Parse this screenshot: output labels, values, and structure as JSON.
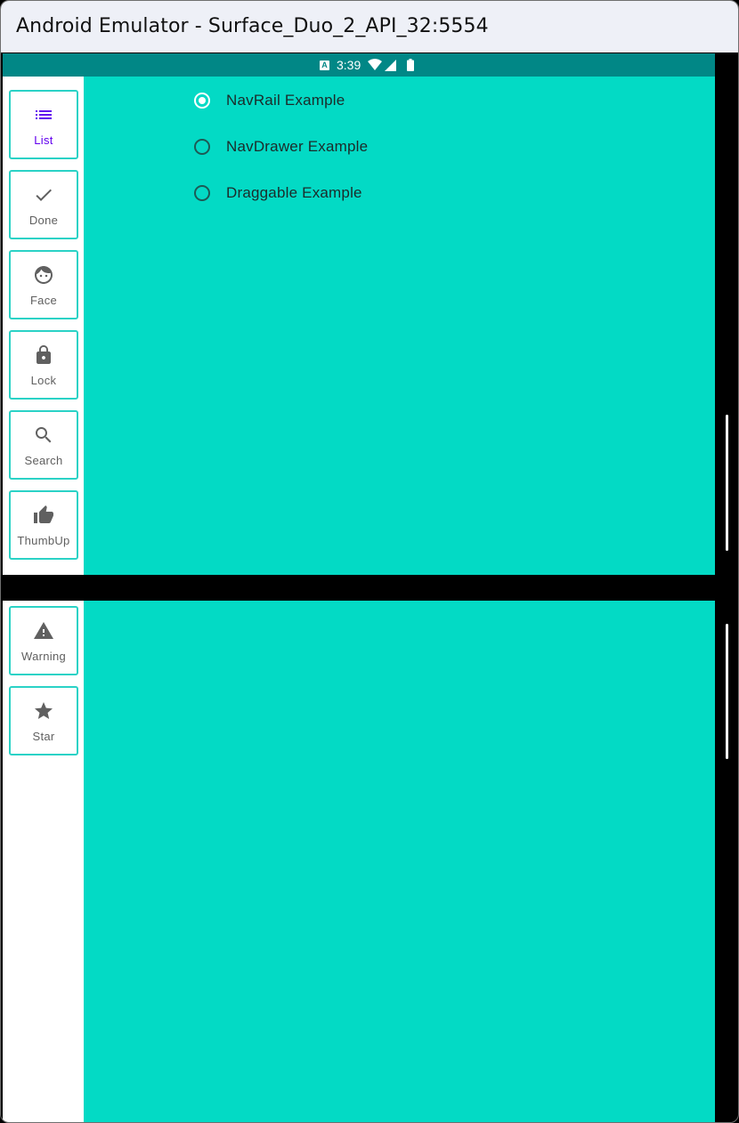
{
  "window": {
    "title": "Android Emulator - Surface_Duo_2_API_32:5554"
  },
  "status_bar": {
    "time": "3:39",
    "icons": [
      "a-notification-icon",
      "wifi-icon",
      "cell-signal-icon",
      "battery-icon"
    ]
  },
  "colors": {
    "status_bar": "#018786",
    "content": "#03dac5",
    "rail_border": "#2ad2c6",
    "selected": "#6200ee"
  },
  "rail_top": [
    {
      "label": "List",
      "icon": "list-icon",
      "selected": true
    },
    {
      "label": "Done",
      "icon": "check-icon",
      "selected": false
    },
    {
      "label": "Face",
      "icon": "face-icon",
      "selected": false
    },
    {
      "label": "Lock",
      "icon": "lock-icon",
      "selected": false
    },
    {
      "label": "Search",
      "icon": "search-icon",
      "selected": false
    },
    {
      "label": "ThumbUp",
      "icon": "thumb-up-icon",
      "selected": false
    }
  ],
  "rail_bottom": [
    {
      "label": "Warning",
      "icon": "warning-icon",
      "selected": false
    },
    {
      "label": "Star",
      "icon": "star-icon",
      "selected": false
    }
  ],
  "options": [
    {
      "label": "NavRail Example",
      "checked": true
    },
    {
      "label": "NavDrawer Example",
      "checked": false
    },
    {
      "label": "Draggable Example",
      "checked": false
    }
  ]
}
